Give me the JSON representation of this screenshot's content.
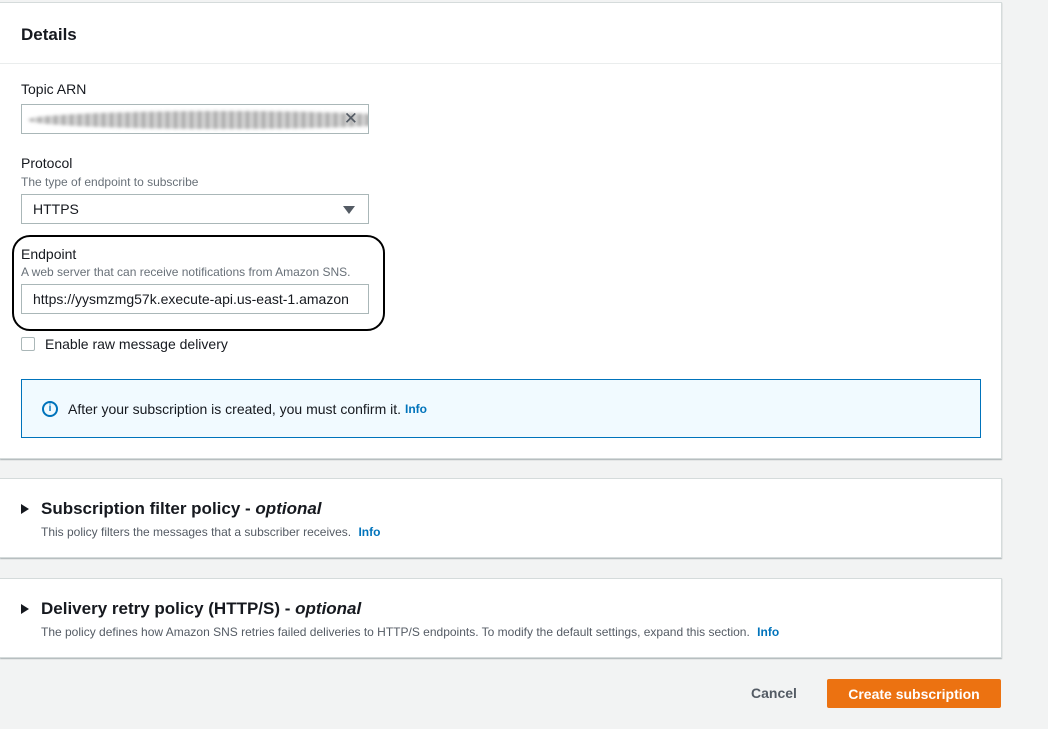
{
  "details": {
    "title": "Details",
    "topic_arn": {
      "label": "Topic ARN",
      "clear_icon": "close-icon"
    },
    "protocol": {
      "label": "Protocol",
      "description": "The type of endpoint to subscribe",
      "value": "HTTPS"
    },
    "endpoint": {
      "label": "Endpoint",
      "description": "A web server that can receive notifications from Amazon SNS.",
      "value": "https://yysmzmg57k.execute-api.us-east-1.amazon"
    },
    "raw_delivery": {
      "label": "Enable raw message delivery",
      "checked": false
    },
    "alert": {
      "text": "After your subscription is created, you must confirm it.",
      "link": "Info"
    }
  },
  "filter_policy": {
    "title": "Subscription filter policy - ",
    "optional": "optional",
    "description": "This policy filters the messages that a subscriber receives.",
    "link": "Info"
  },
  "retry_policy": {
    "title": "Delivery retry policy (HTTP/S) - ",
    "optional": "optional",
    "description": "The policy defines how Amazon SNS retries failed deliveries to HTTP/S endpoints. To modify the default settings, expand this section.",
    "link": "Info"
  },
  "actions": {
    "cancel": "Cancel",
    "create": "Create subscription"
  },
  "colors": {
    "accent": "#ec7211",
    "link": "#0073bb",
    "alert_bg": "#f1faff"
  }
}
